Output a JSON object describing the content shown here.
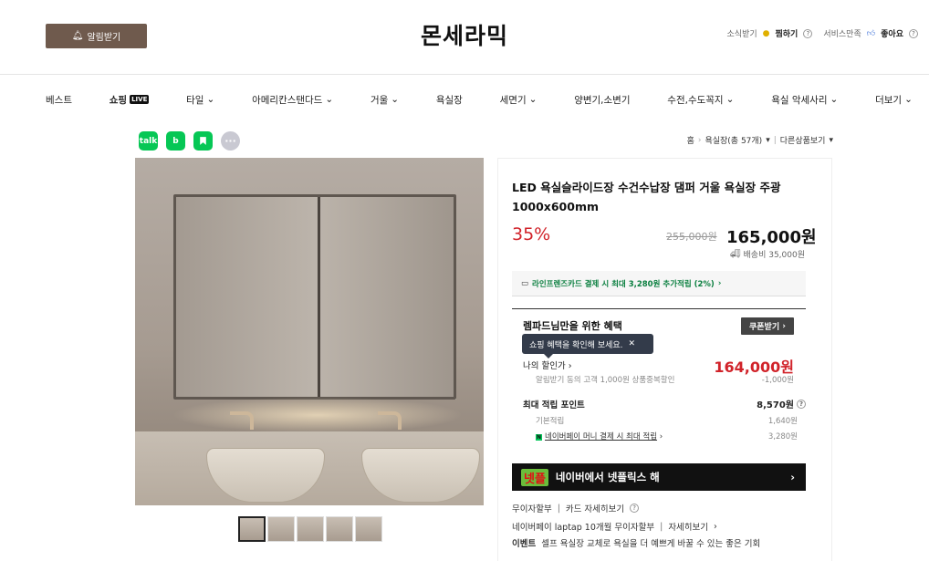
{
  "header": {
    "alarm_label": "알림받기",
    "brand": "몬세라믹",
    "neighbor_label": "소식받기",
    "premium_label": "찜하기",
    "service_label": "서비스만족",
    "like_label": "좋아요"
  },
  "nav": {
    "items": [
      {
        "label": "베스트",
        "dropdown": false
      },
      {
        "label": "쇼핑",
        "badge": "LIVE",
        "dropdown": false
      },
      {
        "label": "타일",
        "dropdown": true
      },
      {
        "label": "아메리칸스탠다드",
        "dropdown": true
      },
      {
        "label": "거울",
        "dropdown": true
      },
      {
        "label": "욕실장",
        "dropdown": false
      },
      {
        "label": "세면기",
        "dropdown": true
      },
      {
        "label": "양변기,소변기",
        "dropdown": false
      },
      {
        "label": "수전,수도꼭지",
        "dropdown": true
      },
      {
        "label": "욕실 악세사리",
        "dropdown": true
      },
      {
        "label": "더보기",
        "dropdown": true
      }
    ]
  },
  "share": {
    "icons": [
      "talk",
      "band",
      "bookmark",
      "more"
    ],
    "labels": {
      "talk": "talk",
      "band": "b",
      "bookmark": "",
      "more": "···"
    }
  },
  "breadcrumb": {
    "home": "홈",
    "category": "욕실장(총 57개)",
    "other": "다른상품보기"
  },
  "product": {
    "title": "LED 욕실슬라이드장 수건수납장 댐퍼 거울 욕실장 주광 1000x600mm",
    "discount": "35%",
    "original_price": "255,000원",
    "price": "165,000원",
    "shipping": "배송비 35,000원"
  },
  "card_promo": "라인프렌즈카드 결제 시 최대 3,280원 추가적립 (2%)",
  "benefits": {
    "title": "렘파드님만을 위한 혜택",
    "coupon_button": "쿠폰받기",
    "tooltip": "쇼핑 혜택을 확인해 보세요.",
    "my_discount_label": "나의 할인가",
    "my_discount_price": "164,000원",
    "alarm_coupon_label": "알림받기 동의 고객 1,000원 상품중복할인",
    "alarm_coupon_amount": "-1,000원",
    "points_title": "최대 적립 포인트",
    "points_total": "8,570원",
    "base_points_label": "기본적립",
    "base_points_amount": "1,640원",
    "npay_label": "네이버페이 머니 결제 시 최대 적립",
    "npay_badge": "N",
    "npay_amount": "3,280원"
  },
  "netflix_banner": {
    "logo": "넷플",
    "text": "네이버에서 넷플릭스 해"
  },
  "info_lines": [
    {
      "label": "무이자할부",
      "link": "카드 자세히보기"
    },
    {
      "label": "네이버페이 laptap 10개월 무이자할부",
      "link": "자세히보기"
    },
    {
      "label": "이벤트",
      "link": "셀프 욕실장 교체로 욕실을 더 예쁘게 바꿀 수 있는 좋은 기회"
    }
  ],
  "colors": {
    "brand_button": "#6f5a4d",
    "discount_red": "#d1232a",
    "naver_green": "#03c75a",
    "tooltip_bg": "#333b4a"
  },
  "thumbnails": {
    "count": 5,
    "active": 0
  }
}
